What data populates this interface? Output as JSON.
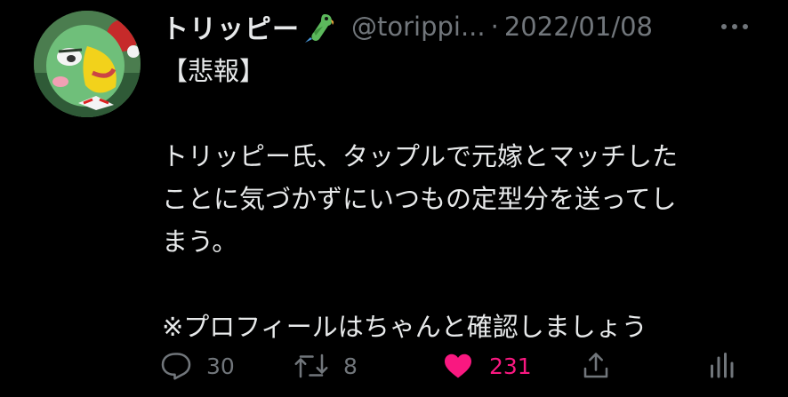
{
  "tweet": {
    "display_name": "トリッピー",
    "name_emoji": "parrot-emoji",
    "handle": "@torippi...",
    "separator": "·",
    "date": "2022/01/08",
    "text": "【悲報】\n\nトリッピー氏、タップルで元嫁とマッチした\nことに気づかずにいつもの定型分を送ってし\nまう。\n\n※プロフィールはちゃんと確認しましょう"
  },
  "actions": {
    "reply_count": "30",
    "retweet_count": "8",
    "like_count": "231"
  },
  "icons": {
    "reply": "reply-icon",
    "retweet": "retweet-icon",
    "like": "heart-icon",
    "share": "share-icon",
    "analytics": "analytics-icon",
    "more": "more-icon"
  },
  "colors": {
    "background": "#000000",
    "text_primary": "#e7e9ea",
    "text_secondary": "#71767b",
    "like_active": "#f91880"
  }
}
